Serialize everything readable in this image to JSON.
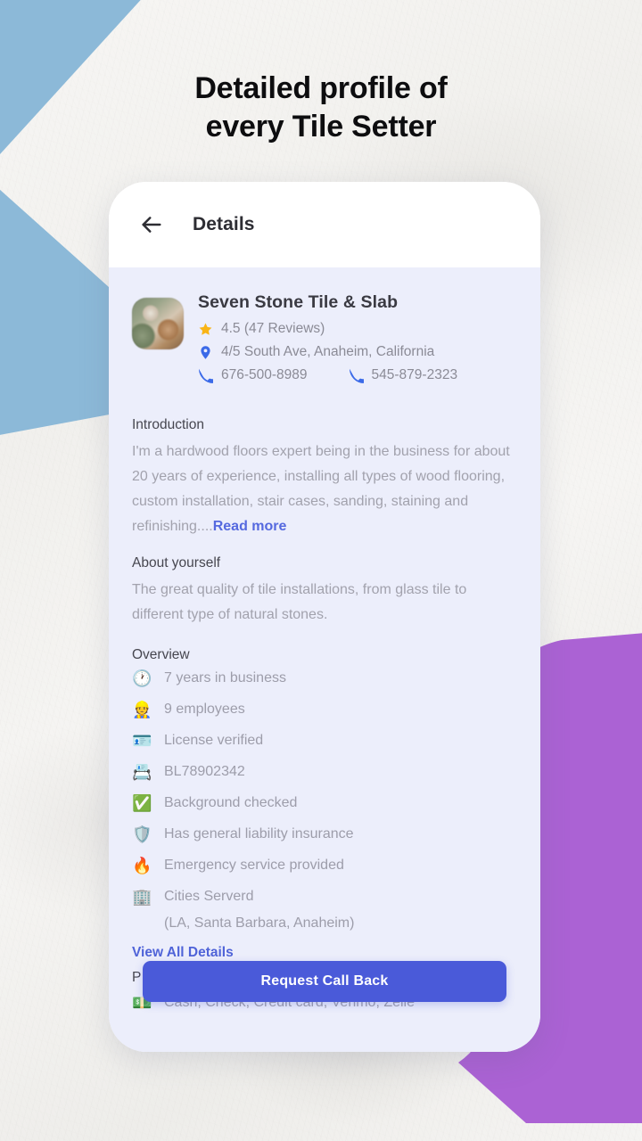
{
  "promo": {
    "headline_line1": "Detailed profile of",
    "headline_line2": "every Tile Setter"
  },
  "colors": {
    "accent_blue": "#4a5ad9",
    "link_blue": "#4f63d8",
    "shape_blue": "#8cb9d8",
    "shape_purple": "#ab62d4",
    "card_bg": "#eceefb",
    "muted_text": "#9d9daa"
  },
  "appbar": {
    "back_icon": "arrow-left-icon",
    "title": "Details"
  },
  "business": {
    "avatar_alt": "business-avatar",
    "name": "Seven Stone Tile & Slab",
    "rating_icon": "star-icon",
    "rating_text": "4.5 (47 Reviews)",
    "address_icon": "location-pin-icon",
    "address": "4/5 South Ave, Anaheim, California",
    "phone_icon": "phone-icon",
    "phone_primary": "676-500-8989",
    "phone_secondary": "545-879-2323"
  },
  "introduction": {
    "title": "Introduction",
    "body": "I'm a hardwood floors expert being in the business for about 20 years of experience, installing all types of wood flooring, custom installation, stair cases, sanding, staining and refinishing....",
    "read_more": "Read more"
  },
  "about": {
    "title": "About yourself",
    "body": "The great quality of tile installations, from glass tile to different type of natural stones."
  },
  "overview": {
    "title": "Overview",
    "items": [
      {
        "emoji": "🕐",
        "icon_name": "clock-icon",
        "label": "7 years in business"
      },
      {
        "emoji": "👷",
        "icon_name": "worker-icon",
        "label": "9 employees"
      },
      {
        "emoji": "🪪",
        "icon_name": "id-card-icon",
        "label": "License verified"
      },
      {
        "emoji": "📇",
        "icon_name": "card-index-icon",
        "label": "BL78902342"
      },
      {
        "emoji": "✅",
        "icon_name": "check-mark-icon",
        "label": "Background checked"
      },
      {
        "emoji": "🛡️",
        "icon_name": "shield-icon",
        "label": "Has general liability insurance"
      },
      {
        "emoji": "🔥",
        "icon_name": "fire-icon",
        "label": "Emergency service provided"
      },
      {
        "emoji": "🏢",
        "icon_name": "office-building-icon",
        "label": "Cities Serverd",
        "sub": "(LA, Santa Barbara, Anaheim)"
      }
    ],
    "view_all": "View All Details"
  },
  "payment": {
    "title_partial": "P",
    "emoji": "💵",
    "icon_name": "money-icon",
    "methods": "Cash, Check, Credit card, Venmo, Zelle"
  },
  "cta": {
    "label": "Request Call Back"
  }
}
